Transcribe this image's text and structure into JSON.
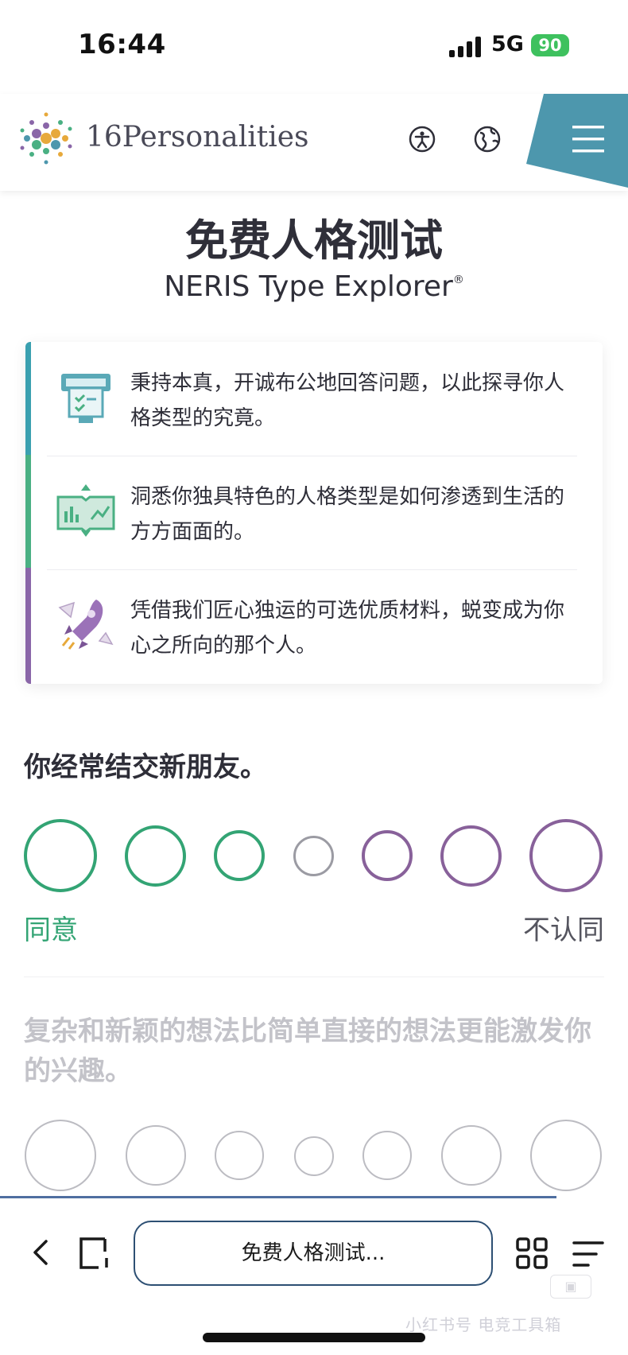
{
  "status_bar": {
    "time": "16:44",
    "network": "5G",
    "battery": "90"
  },
  "header": {
    "logo_text": "16Personalities"
  },
  "hero": {
    "title": "免费人格测试",
    "subtitle": "NERIS Type Explorer",
    "subtitle_mark": "®"
  },
  "features": [
    {
      "text": "秉持本真，开诚布公地回答问题，以此探寻你人格类型的究竟。",
      "icon": "voting-machine-icon"
    },
    {
      "text": "洞悉你独具特色的人格类型是如何渗透到生活的方方面面的。",
      "icon": "open-book-chart-icon"
    },
    {
      "text": "凭借我们匠心独运的可选优质材料，蜕变成为你心之所向的那个人。",
      "icon": "rocket-icon"
    }
  ],
  "questions": [
    {
      "text": "你经常结交新朋友。",
      "agree_label": "同意",
      "disagree_label": "不认同",
      "answered": false
    },
    {
      "text": "复杂和新颖的想法比简单直接的想法更能激发你的兴趣。",
      "active": false
    }
  ],
  "colors": {
    "agree": "#33a474",
    "neutral": "#9b9ba3",
    "disagree": "#88619a",
    "accent_blue": "#4d97ad"
  },
  "browser": {
    "url_title": "免费人格测试...",
    "watermark": "小红书号 电竞工具箱"
  }
}
